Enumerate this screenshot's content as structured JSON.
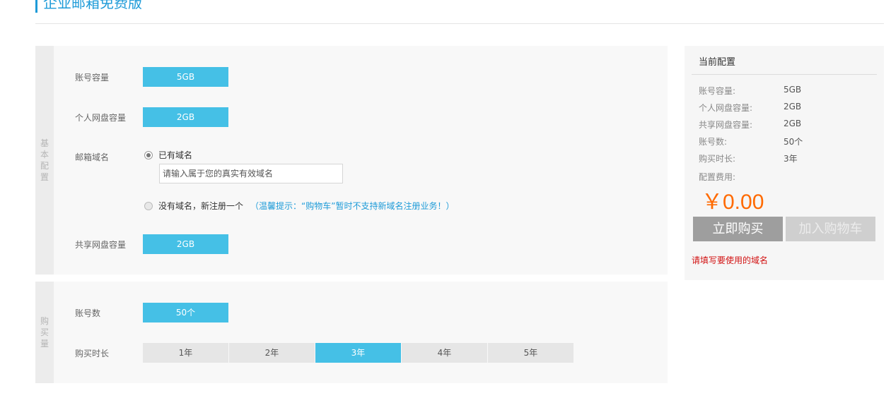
{
  "page": {
    "title": "企业邮箱免费版"
  },
  "basic": {
    "side_label": "基本配置",
    "account_capacity": {
      "label": "账号容量",
      "value": "5GB"
    },
    "personal_disk": {
      "label": "个人网盘容量",
      "value": "2GB"
    },
    "mail_domain": {
      "label": "邮箱域名",
      "option_have": "已有域名",
      "input_placeholder": "请输入属于您的真实有效域名",
      "option_none": "没有域名，新注册一个",
      "tip": "（温馨提示：“购物车”暂时不支持新域名注册业务！）"
    },
    "shared_disk": {
      "label": "共享网盘容量",
      "value": "2GB"
    }
  },
  "purchase": {
    "side_label": "购买量",
    "accounts": {
      "label": "账号数",
      "value": "50个"
    },
    "duration": {
      "label": "购买时长",
      "options": [
        "1年",
        "2年",
        "3年",
        "4年",
        "5年"
      ],
      "selected": "3年"
    }
  },
  "summary": {
    "title": "当前配置",
    "rows": [
      {
        "k": "账号容量:",
        "v": "5GB"
      },
      {
        "k": "个人网盘容量:",
        "v": "2GB"
      },
      {
        "k": "共享网盘容量:",
        "v": "2GB"
      },
      {
        "k": "账号数:",
        "v": "50个"
      },
      {
        "k": "购买时长:",
        "v": "3年"
      }
    ],
    "fee_label": "配置费用:",
    "price": "￥0.00",
    "buy_label": "立即购买",
    "cart_label": "加入购物车",
    "warning": "请填写要使用的域名"
  },
  "colors": {
    "accent": "#45c0e6",
    "price": "#ff6a00",
    "warning": "#d21212",
    "link": "#1e9bd8"
  }
}
